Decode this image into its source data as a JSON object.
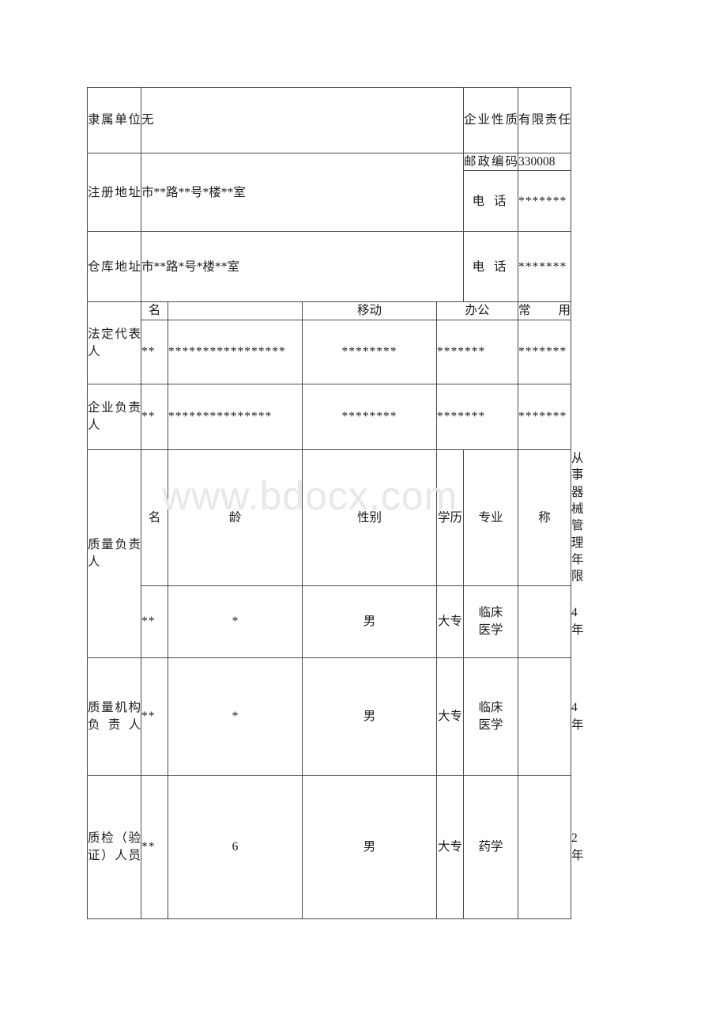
{
  "document": {
    "watermark": "www.bdocx.com"
  },
  "table": {
    "rows": {
      "affiliated_unit": {
        "label": "隶属单位",
        "value": "无",
        "nature_label": "企业性质",
        "nature_value": "有限责任"
      },
      "registered_address": {
        "label": "注册地址",
        "value": "市**路**号*楼**室",
        "postcode_label": "邮政编码",
        "postcode_value": "330008",
        "phone_label": "电 话",
        "phone_value": "*******"
      },
      "warehouse_address": {
        "label": "仓库地址",
        "value": "市**路*号*楼**室",
        "phone_label": "电 话",
        "phone_value": "*******"
      },
      "legal_representative": {
        "label": "法定代表人",
        "head_name": "名",
        "head_mobile": "移动",
        "head_office": "办公",
        "head_common": "常用",
        "name": "**",
        "id_stars": "*****************",
        "mobile": "********",
        "office": "*******",
        "common": "*******"
      },
      "enterprise_head": {
        "label": "企业负责人",
        "name": "**",
        "id_stars": "***************",
        "mobile": "********",
        "office": "*******",
        "common": "*******"
      },
      "quality_head": {
        "label": "质量负责人",
        "head_name": "名",
        "head_age": "龄",
        "head_gender": "性别",
        "head_education": "学历",
        "head_major": "专业",
        "head_title": "称",
        "head_years": "从事器械管理年限",
        "name": "**",
        "age": "*",
        "gender": "男",
        "education": "大专",
        "major_line1": "临床",
        "major_line2": "医学",
        "title": "",
        "years": "4年"
      },
      "quality_org_head": {
        "label": "质量机构负责人",
        "name": "**",
        "age": "*",
        "gender": "男",
        "education": "大专",
        "major_line1": "临床",
        "major_line2": "医学",
        "title": "",
        "years": "4年"
      },
      "inspection_staff": {
        "label": "质检（验证）人员",
        "name": "**",
        "age": "6",
        "gender": "男",
        "education": "大专",
        "major": "药学",
        "title": "",
        "years": "2年"
      }
    }
  }
}
